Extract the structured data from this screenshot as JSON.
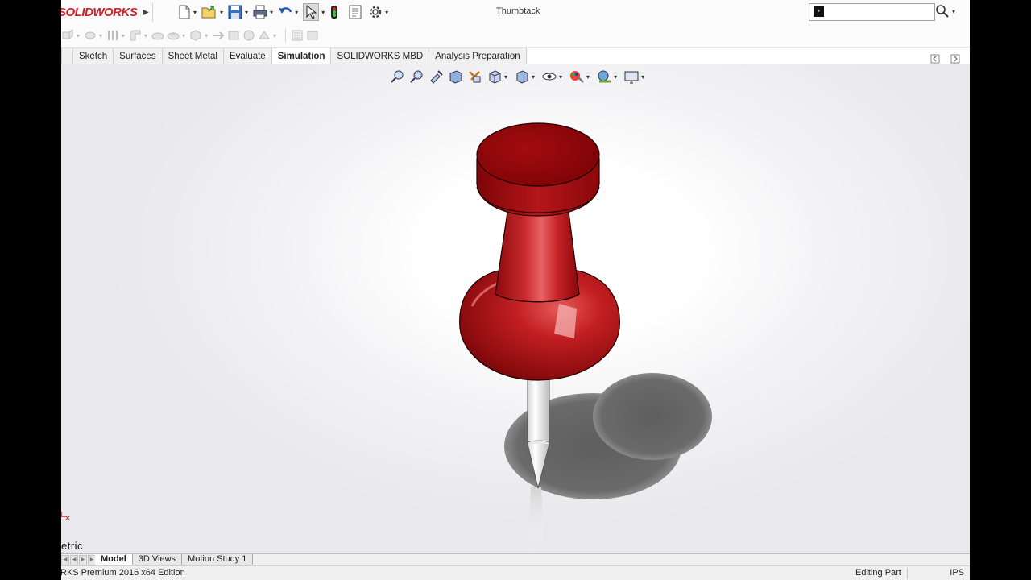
{
  "app": {
    "logo_text": "SOLIDWORKS",
    "document_title": "Thumbtack",
    "brand_color": "#d0202a"
  },
  "quick_access": [
    {
      "name": "new-document",
      "icon": "new-document-icon"
    },
    {
      "name": "open",
      "icon": "open-folder-icon"
    },
    {
      "name": "save",
      "icon": "save-icon"
    },
    {
      "name": "print",
      "icon": "print-icon"
    },
    {
      "name": "undo",
      "icon": "undo-icon"
    },
    {
      "name": "select",
      "icon": "select-arrow-icon"
    },
    {
      "name": "rebuild",
      "icon": "traffic-light-icon"
    },
    {
      "name": "file-properties",
      "icon": "file-properties-icon"
    },
    {
      "name": "options",
      "icon": "gear-icon"
    }
  ],
  "search": {
    "placeholder": "",
    "value": ""
  },
  "tabs": [
    {
      "label": "",
      "active": false
    },
    {
      "label": "Sketch",
      "active": false
    },
    {
      "label": "Surfaces",
      "active": false
    },
    {
      "label": "Sheet Metal",
      "active": false
    },
    {
      "label": "Evaluate",
      "active": false
    },
    {
      "label": "Simulation",
      "active": true
    },
    {
      "label": "SOLIDWORKS MBD",
      "active": false
    },
    {
      "label": "Analysis Preparation",
      "active": false
    }
  ],
  "heads_up_toolbar": [
    "zoom-to-fit-icon",
    "zoom-to-area-icon",
    "previous-view-icon",
    "section-view-icon",
    "dynamic-annotation-icon",
    "view-orientation-icon",
    "display-style-icon",
    "hide-show-items-icon",
    "edit-appearance-icon",
    "apply-scene-icon",
    "view-settings-icon"
  ],
  "viewport": {
    "view_label": "etric",
    "model_color": "#b3161b"
  },
  "bottom_tabs": [
    {
      "label": "Model",
      "active": true
    },
    {
      "label": "3D Views",
      "active": false
    },
    {
      "label": "Motion Study 1",
      "active": false
    }
  ],
  "status": {
    "edition": "RKS Premium 2016 x64 Edition",
    "mode": "Editing Part",
    "units": "IPS"
  }
}
